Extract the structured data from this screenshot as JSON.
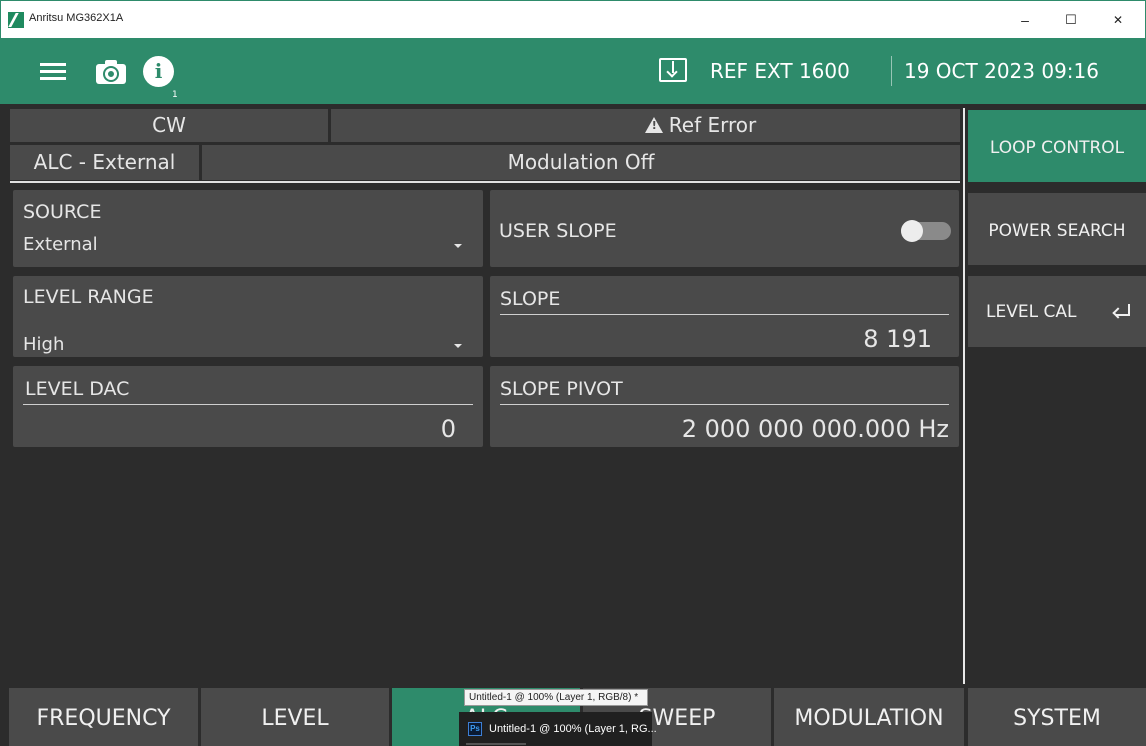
{
  "window": {
    "title": "Anritsu MG362X1A",
    "minimize": "–",
    "maximize": "☐",
    "close": "✕"
  },
  "header": {
    "info_badge": "1",
    "reference": "REF EXT 1600",
    "datetime": "19 OCT 2023 09:16"
  },
  "status": {
    "mode": "CW",
    "error": "Ref Error",
    "alc_mode": "ALC - External",
    "modulation": "Modulation Off"
  },
  "panels": {
    "source": {
      "label": "SOURCE",
      "value": "External"
    },
    "user_slope": {
      "label": "USER SLOPE",
      "enabled": false
    },
    "level_range": {
      "label": "LEVEL RANGE",
      "value": "High"
    },
    "slope": {
      "label": "SLOPE",
      "value": "8  191"
    },
    "level_dac": {
      "label": "LEVEL DAC",
      "value": "0"
    },
    "slope_pivot": {
      "label": "SLOPE PIVOT",
      "value": "2  000  000  000.000 Hz"
    }
  },
  "side_menu": [
    {
      "label": "LOOP CONTROL",
      "active": true
    },
    {
      "label": "POWER SEARCH",
      "active": false
    },
    {
      "label": "LEVEL CAL",
      "active": false
    }
  ],
  "tabs": [
    {
      "label": "FREQUENCY",
      "active": false
    },
    {
      "label": "LEVEL",
      "active": false
    },
    {
      "label": "ALC",
      "active": true
    },
    {
      "label": "SWEEP",
      "active": false
    },
    {
      "label": "MODULATION",
      "active": false
    },
    {
      "label": "SYSTEM",
      "active": false
    }
  ],
  "taskbar_preview": {
    "tooltip": "Untitled-1 @ 100% (Layer 1, RGB/8) *",
    "app_badge": "Ps",
    "thumbnail_title": "Untitled-1 @ 100% (Layer 1, RG..."
  },
  "colors": {
    "accent": "#2e8b6b",
    "panel": "#4a4a4a",
    "background": "#2c2c2c"
  }
}
